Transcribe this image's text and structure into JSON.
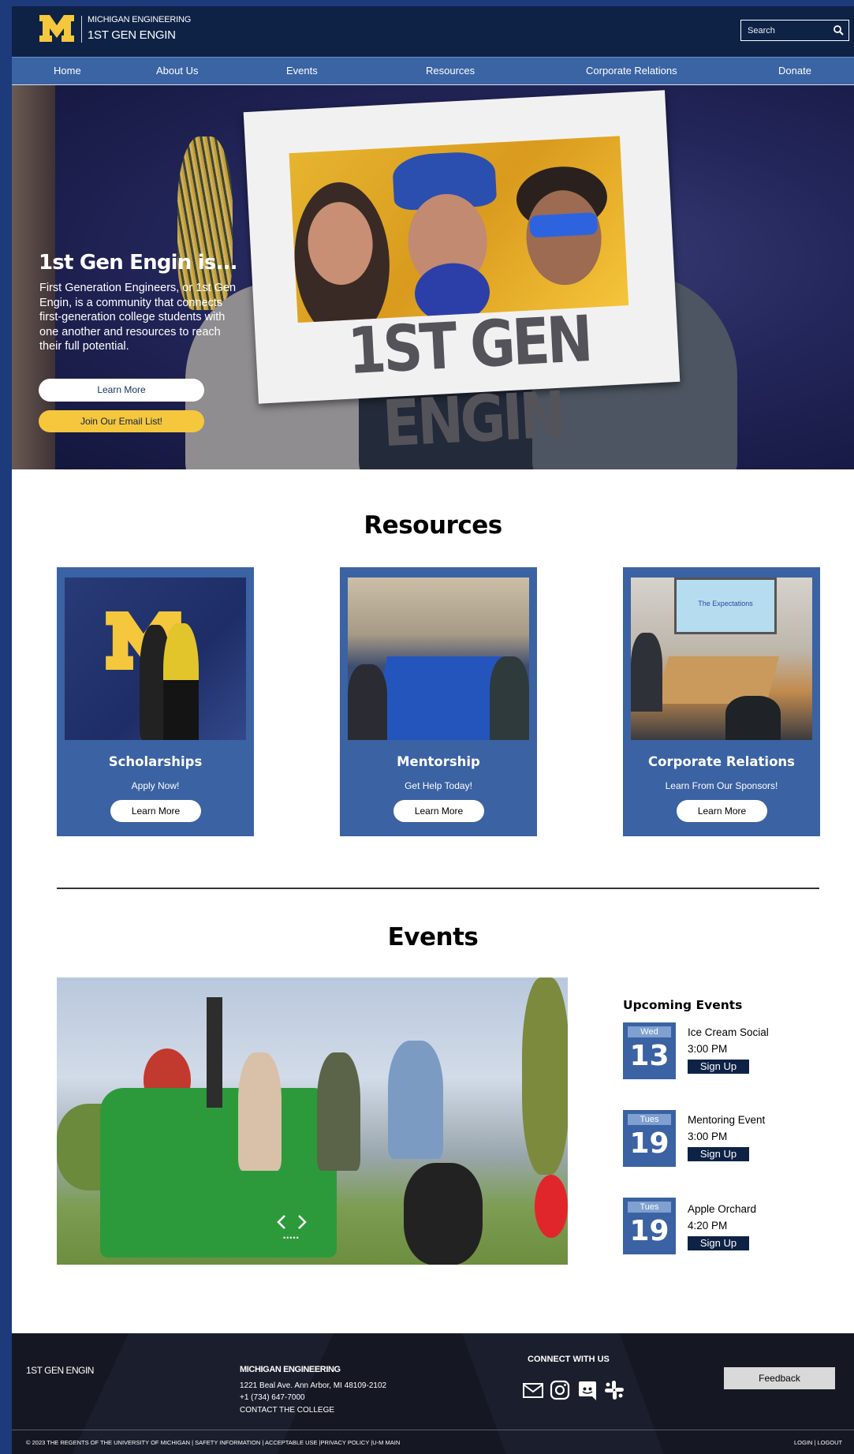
{
  "header": {
    "logo_line1": "MICHIGAN ENGINEERING",
    "logo_line2": "1ST GEN ENGIN",
    "search_placeholder": "Search",
    "icons": {
      "logo": "block-m-logo",
      "search": "search-icon"
    },
    "colors": {
      "primary": "#0e2246",
      "nav": "#3a64a4",
      "accent": "#f5c73c"
    }
  },
  "nav": {
    "items": [
      {
        "label": "Home"
      },
      {
        "label": "About Us"
      },
      {
        "label": "Events"
      },
      {
        "label": "Resources"
      },
      {
        "label": "Corporate Relations"
      },
      {
        "label": "Donate"
      }
    ]
  },
  "hero": {
    "title": "1st Gen Engin is...",
    "description": "First Generation Engineers, or 1st Gen Engin, is a community that connects first-generation college students with one another and resources to reach their full potential.",
    "learn_more": "Learn More",
    "email_list": "Join Our Email List!",
    "frame_text": "1ST GEN ENGIN"
  },
  "resources": {
    "title": "Resources",
    "cards": [
      {
        "title": "Scholarships",
        "subtitle": "Apply Now!",
        "button": "Learn More"
      },
      {
        "title": "Mentorship",
        "subtitle": "Get Help Today!",
        "button": "Learn More"
      },
      {
        "title": "Corporate Relations",
        "subtitle": "Learn From Our Sponsors!",
        "button": "Learn More",
        "screen_text": "The Expectations"
      }
    ]
  },
  "events": {
    "title": "Events",
    "upcoming_title": "Upcoming Events",
    "list": [
      {
        "day": "Wed",
        "date": "13",
        "name": "Ice Cream Social",
        "time": "3:00 PM",
        "button": "Sign Up"
      },
      {
        "day": "Tues",
        "date": "19",
        "name": "Mentoring Event",
        "time": "3:00 PM",
        "button": "Sign Up"
      },
      {
        "day": "Tues",
        "date": "19",
        "name": "Apple Orchard",
        "time": "4:20 PM",
        "button": "Sign Up"
      }
    ]
  },
  "footer": {
    "brand": "1ST GEN ENGIN",
    "org": "MICHIGAN ENGINEERING",
    "address": "1221 Beal Ave. Ann Arbor, MI 48109-2102",
    "phone": "+1 (734) 647-7000",
    "contact": "CONTACT THE COLLEGE",
    "connect": "CONNECT WITH US",
    "feedback": "Feedback",
    "legal": "© 2023 THE REGENTS OF THE UNIVERSITY OF MICHIGAN | SAFETY INFORMATION | ACCEPTABLE USE |PRIVACY POLICY |U-M MAIN",
    "login_logout": "LOGIN | LOGOUT",
    "social_icons": [
      "mail-icon",
      "instagram-icon",
      "discord-icon",
      "slack-icon"
    ]
  }
}
